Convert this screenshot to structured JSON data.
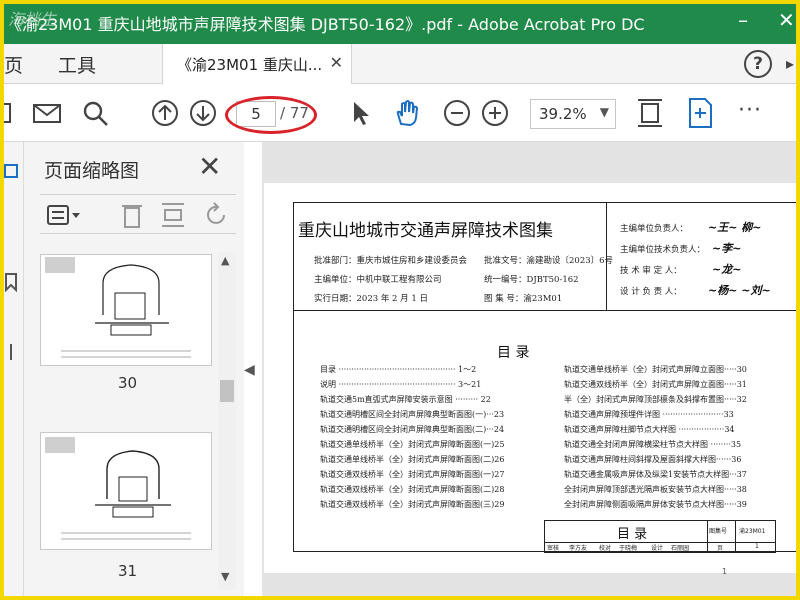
{
  "window": {
    "title": "《渝23M01 重庆山地城市声屏障技术图集 DJBT50-162》.pdf - Adobe Acrobat Pro DC",
    "watermark": "海档生"
  },
  "menu": {
    "items": [
      "页",
      "工具"
    ],
    "tab_label": "《渝23M01 重庆山...",
    "help": "?",
    "more": "▸"
  },
  "toolbar": {
    "page_current": "5",
    "page_total": "/ 77",
    "zoom": "39.2%",
    "more": "···"
  },
  "panel": {
    "title": "页面缩略图",
    "thumbnails": [
      {
        "page": "30"
      },
      {
        "page": "31"
      }
    ]
  },
  "document": {
    "title": "重庆山地城市交通声屏障技术图集",
    "info_left": [
      "批准部门：重庆市城住房和乡建设委员会",
      "主编单位：中机中联工程有限公司",
      "实行日期：2023 年 2 月 1 日"
    ],
    "info_mid": [
      "批准文号：渝建勘设〔2023〕6号",
      "统一编号：DJBT50-162",
      "图  集  号：渝23M01"
    ],
    "info_right": [
      "主编单位负责人：",
      "主编单位技术负责人：",
      "技  术  审  定  人：",
      "设  计  负  责  人："
    ],
    "toc_title": "目    录",
    "toc_left": [
      "目录 ·············································· 1～2",
      "说明 ·············································· 3～21",
      "轨道交通5m直弧式声屏障安装示意图 ········· 22",
      "轨道交通明槽区间全封闭声屏障典型断面图(一)···23",
      "轨道交通明槽区间全封闭声屏障典型断面图(二)···24",
      "轨道交通单线桥半（全）封闭式声屏障断面图(一)25",
      "轨道交通单线桥半（全）封闭式声屏障断面图(二)26",
      "轨道交通双线桥半（全）封闭式声屏障断面图(一)27",
      "轨道交通双线桥半（全）封闭式声屏障断面图(二)28",
      "轨道交通双线桥半（全）封闭式声屏障断面图(三)29"
    ],
    "toc_right": [
      "轨道交通单线桥半（全）封闭式声屏障立面图·····30",
      "轨道交通双线桥半（全）封闭式声屏障立面图·····31",
      "半（全）封闭式声屏障顶部檩条及斜撑布置图·····32",
      "轨道交通声屏障预埋件详图 ························33",
      "轨道交通声屏障柱脚节点大样图 ··················34",
      "轨道交通全封闭声屏障横梁柱节点大样图 ········35",
      "轨道交通声屏障柱间斜撑及屋面斜撑大样图······36",
      "轨道交通金属吸声屏体及纵梁1安装节点大样图···37",
      "全封闭声屏障顶部透光隔声板安装节点大样图·····38",
      "全封闭声屏障侧面吸隔声屏体安装节点大样图·····39"
    ],
    "titleblock": {
      "heading": "目    录",
      "fig_label": "图集号",
      "fig_value": "渝23M01",
      "page_label": "页",
      "page_value": "1",
      "row": [
        "审核",
        "李方友",
        "校对",
        "于晓梅",
        "设计",
        "石丽园"
      ]
    },
    "page_footer": "1"
  }
}
